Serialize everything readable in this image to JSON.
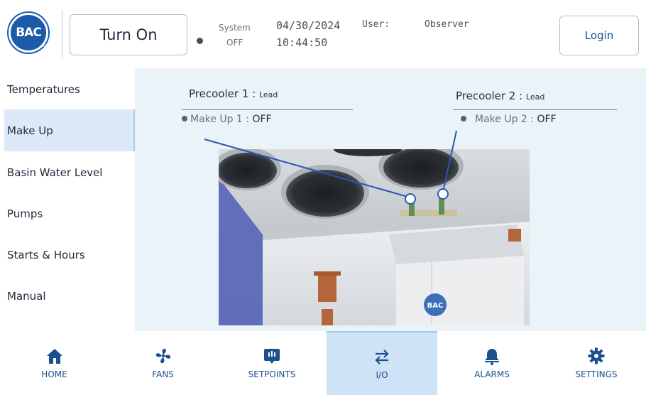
{
  "header": {
    "logo_text": "BAC",
    "logo_reg": "®",
    "turn_on_label": "Turn On",
    "system_label": "System",
    "system_value": "OFF",
    "date": "04/30/2024",
    "time": "10:44:50",
    "user_label": "User:",
    "user_value": "Observer",
    "login_label": "Login"
  },
  "sidebar": {
    "items": [
      {
        "label": "Temperatures"
      },
      {
        "label": "Make Up"
      },
      {
        "label": "Basin Water Level"
      },
      {
        "label": "Pumps"
      },
      {
        "label": "Starts & Hours"
      },
      {
        "label": "Manual"
      }
    ],
    "active_index": 1
  },
  "main": {
    "precooler1": {
      "title": "Precooler 1 :",
      "role": "Lead",
      "makeup_label": "Make Up 1 :",
      "makeup_value": "OFF"
    },
    "precooler2": {
      "title": "Precooler 2 :",
      "role": "Lead",
      "makeup_label": "Make Up 2 :",
      "makeup_value": "OFF"
    },
    "photo_badge": "BAC"
  },
  "bottom_nav": {
    "items": [
      {
        "label": "HOME",
        "icon": "home-icon"
      },
      {
        "label": "FANS",
        "icon": "fan-icon"
      },
      {
        "label": "SETPOINTS",
        "icon": "setpoints-icon"
      },
      {
        "label": "I/O",
        "icon": "swap-arrows-icon"
      },
      {
        "label": "ALARMS",
        "icon": "bell-icon"
      },
      {
        "label": "SETTINGS",
        "icon": "gear-icon"
      }
    ],
    "active_index": 3
  },
  "colors": {
    "brand_blue": "#1b5aa8",
    "nav_text": "#1b4f8f",
    "active_bg": "#cfe3f6",
    "content_bg": "#eaf3f8",
    "connector_line": "#2b56b8"
  }
}
